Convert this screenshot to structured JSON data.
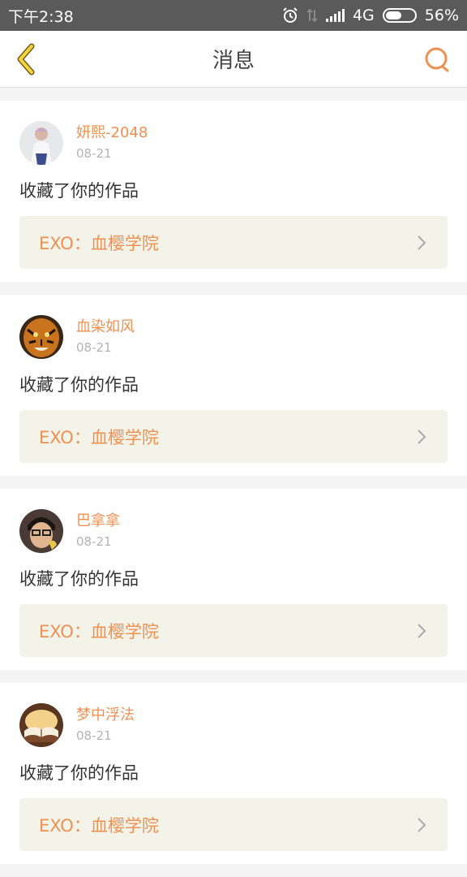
{
  "status": {
    "time": "下午2:38",
    "network": "4G",
    "battery": "56%",
    "battery_level": 0.56
  },
  "header": {
    "title": "消息",
    "back_icon": "chevron-left-icon",
    "search_icon": "search-icon",
    "accent": "#f09050"
  },
  "messages": [
    {
      "user": "妍熙-2048",
      "date": "08-21",
      "action": "收藏了你的作品",
      "work": "EXO：血樱学院"
    },
    {
      "user": "血染如风",
      "date": "08-21",
      "action": "收藏了你的作品",
      "work": "EXO：血樱学院"
    },
    {
      "user": "巴拿拿",
      "date": "08-21",
      "action": "收藏了你的作品",
      "work": "EXO：血樱学院"
    },
    {
      "user": "梦中浮法",
      "date": "08-21",
      "action": "收藏了你的作品",
      "work": "EXO：血樱学院"
    }
  ]
}
